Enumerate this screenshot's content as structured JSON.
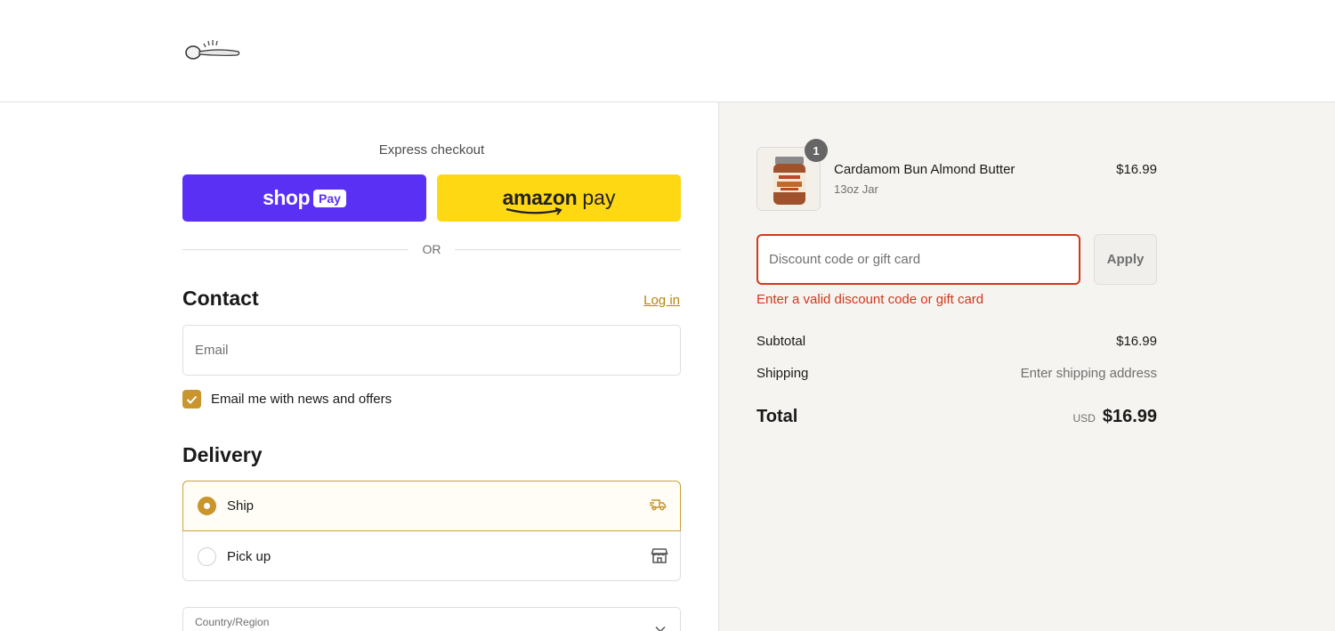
{
  "express": {
    "title": "Express checkout",
    "shop_label": "shop",
    "shop_pay_badge": "Pay",
    "amazon_label": "amazon",
    "amazon_pay": "pay",
    "or": "OR"
  },
  "contact": {
    "heading": "Contact",
    "login": "Log in",
    "email_placeholder": "Email",
    "newsletter_label": "Email me with news and offers"
  },
  "delivery": {
    "heading": "Delivery",
    "options": [
      {
        "label": "Ship",
        "selected": true,
        "icon": "truck-icon"
      },
      {
        "label": "Pick up",
        "selected": false,
        "icon": "store-icon"
      }
    ],
    "country_label": "Country/Region"
  },
  "cart": {
    "quantity": "1",
    "product_name": "Cardamom Bun Almond Butter",
    "variant": "13oz Jar",
    "price": "$16.99"
  },
  "discount": {
    "placeholder": "Discount code or gift card",
    "apply": "Apply",
    "error": "Enter a valid discount code or gift card"
  },
  "summary": {
    "subtotal_label": "Subtotal",
    "subtotal_value": "$16.99",
    "shipping_label": "Shipping",
    "shipping_value": "Enter shipping address",
    "total_label": "Total",
    "currency": "USD",
    "total_value": "$16.99"
  },
  "colors": {
    "accent": "#c9952c",
    "shop_pay": "#5a31f4",
    "amazon_pay": "#ffd814",
    "error": "#d0391c"
  }
}
